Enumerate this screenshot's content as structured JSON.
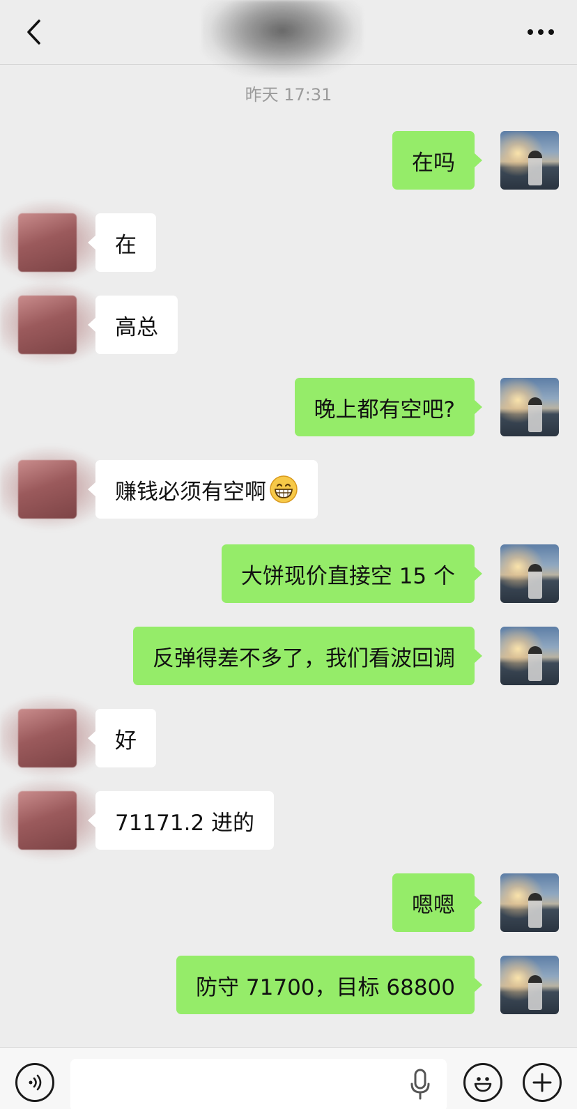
{
  "header": {
    "back_icon": "chevron-left-icon",
    "more_icon": "more-dots-icon"
  },
  "timestamp": "昨天 17:31",
  "messages": [
    {
      "from": "me",
      "text": "在吗"
    },
    {
      "from": "other",
      "text": "在"
    },
    {
      "from": "other",
      "text": "高总"
    },
    {
      "from": "me",
      "text": "晚上都有空吧?"
    },
    {
      "from": "other",
      "text": "赚钱必须有空啊",
      "emoji": "grinning-face-icon"
    },
    {
      "from": "me",
      "text": "大饼现价直接空 15 个"
    },
    {
      "from": "me",
      "text": "反弹得差不多了，我们看波回调"
    },
    {
      "from": "other",
      "text": "好"
    },
    {
      "from": "other",
      "text": "71171.2 进的"
    },
    {
      "from": "me",
      "text": "嗯嗯"
    },
    {
      "from": "me",
      "text": "防守 71700，目标 68800"
    }
  ],
  "input_bar": {
    "voice_icon": "voice-icon",
    "text_value": "",
    "mic_icon": "microphone-icon",
    "emoji_icon": "smiley-icon",
    "plus_icon": "plus-icon"
  },
  "colors": {
    "background": "#ededed",
    "my_bubble": "#95ec69",
    "other_bubble": "#ffffff",
    "timestamp": "#9b9b9b"
  }
}
